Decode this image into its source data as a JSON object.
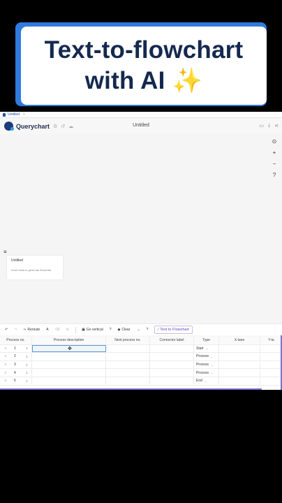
{
  "banner": {
    "line1": "Text-to-flowchart",
    "line2": "with AI",
    "sparkle": "✨"
  },
  "tab": {
    "label": "Untitled",
    "close": "×"
  },
  "app": {
    "brand": "Querychart",
    "document_title": "Untitled",
    "top_icons": [
      "gear-icon",
      "history-icon",
      "cloud-icon"
    ],
    "top_right_icons": [
      "monitor-icon",
      "download-icon",
      "share-icon"
    ]
  },
  "zoom": {
    "fit": "⊙",
    "in": "+",
    "out": "−",
    "help": "?"
  },
  "side_panel": {
    "menu": "≡",
    "title": "Untitled",
    "hint": "Insert data to generate flowchart"
  },
  "toolbar": {
    "undo": "↶",
    "redo": "↷",
    "reroute": "Reroute",
    "text": "A",
    "eraser": "⌫",
    "gear": "⚙",
    "go_vertical": "Go vertical",
    "paint": "?",
    "clear": "Clear",
    "help": "?",
    "text_to_flowchart": "Text to Flowchart"
  },
  "table": {
    "headers": [
      "Process no.",
      "Process description",
      "Next process no.",
      "Connector label",
      "Type",
      "X-lane",
      "Y-la"
    ],
    "rows": [
      {
        "no": "1",
        "desc": "",
        "next": "",
        "label": "",
        "type": "Start"
      },
      {
        "no": "2",
        "desc": "",
        "next": "",
        "label": "",
        "type": "Process"
      },
      {
        "no": "3",
        "desc": "",
        "next": "",
        "label": "",
        "type": "Process"
      },
      {
        "no": "4",
        "desc": "",
        "next": "",
        "label": "",
        "type": "Process"
      },
      {
        "no": "5",
        "desc": "",
        "next": "",
        "label": "",
        "type": "End"
      }
    ]
  },
  "colors": {
    "accent": "#2f7be0",
    "brand": "#1c3b7a",
    "flow_button": "#6a3fb8"
  }
}
